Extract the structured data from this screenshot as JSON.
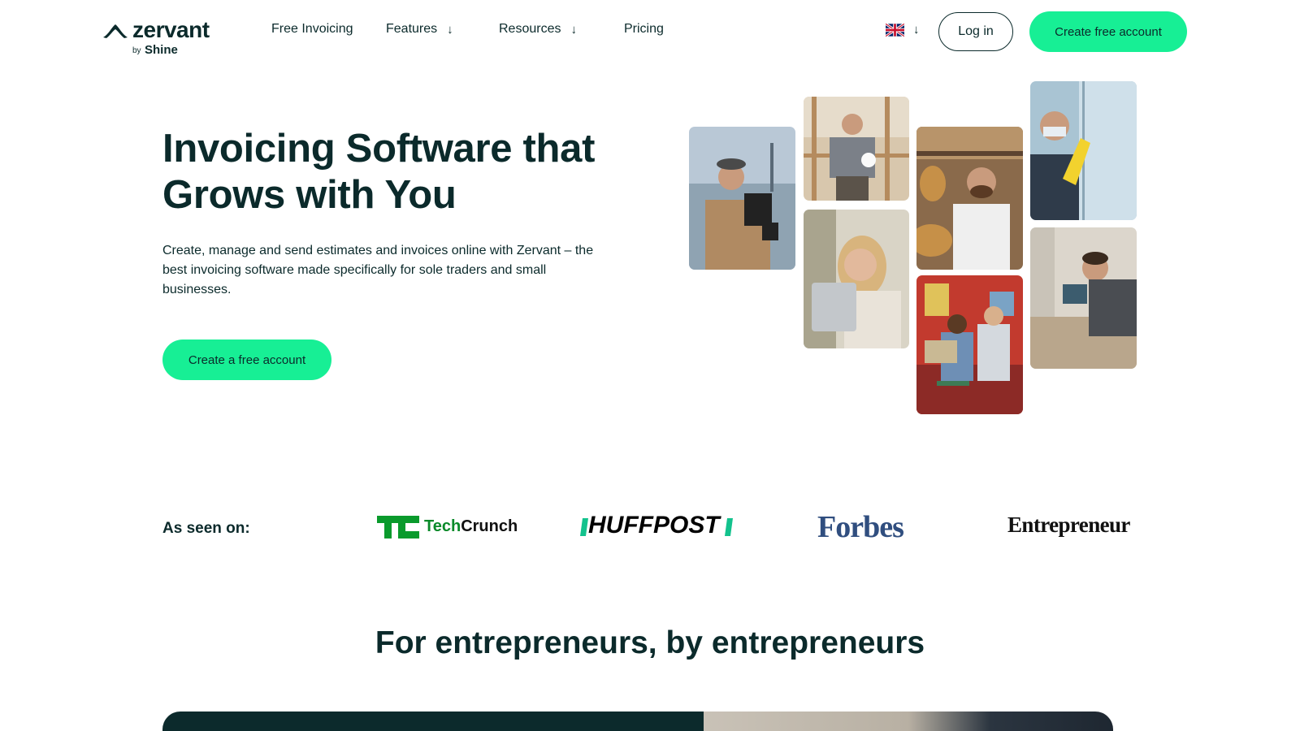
{
  "brand": {
    "name": "zervant",
    "by": "by",
    "parent": "Shine",
    "accent_color": "#17ef95",
    "text_color": "#0b2a2b"
  },
  "nav": {
    "items": [
      {
        "label": "Free Invoicing",
        "has_dropdown": false
      },
      {
        "label": "Features",
        "has_dropdown": true
      },
      {
        "label": "Resources",
        "has_dropdown": true
      },
      {
        "label": "Pricing",
        "has_dropdown": false
      }
    ],
    "dropdown_icon": "arrow-down-icon",
    "language_flag": "uk-flag-icon",
    "login_label": "Log in",
    "create_account_label": "Create free account"
  },
  "hero": {
    "title": "Invoicing Software that Grows with You",
    "subtitle": "Create, manage and send estimates and invoices online with Zervant – the best invoicing software made specifically for sole traders and small businesses.",
    "cta_label": "Create a free account",
    "photos": [
      "videographer-photo",
      "construction-worker-photo",
      "woman-laptop-photo",
      "baker-photo",
      "two-people-laptop-photo",
      "cleaner-photo",
      "electronics-technician-photo"
    ]
  },
  "press": {
    "label": "As seen on:",
    "logos": [
      {
        "name": "TechCrunch",
        "part1": "Tech",
        "part2": "Crunch"
      },
      {
        "name": "HUFFPOST"
      },
      {
        "name": "Forbes"
      },
      {
        "name": "Entrepreneur"
      }
    ]
  },
  "section": {
    "title": "For entrepreneurs, by entrepreneurs"
  }
}
